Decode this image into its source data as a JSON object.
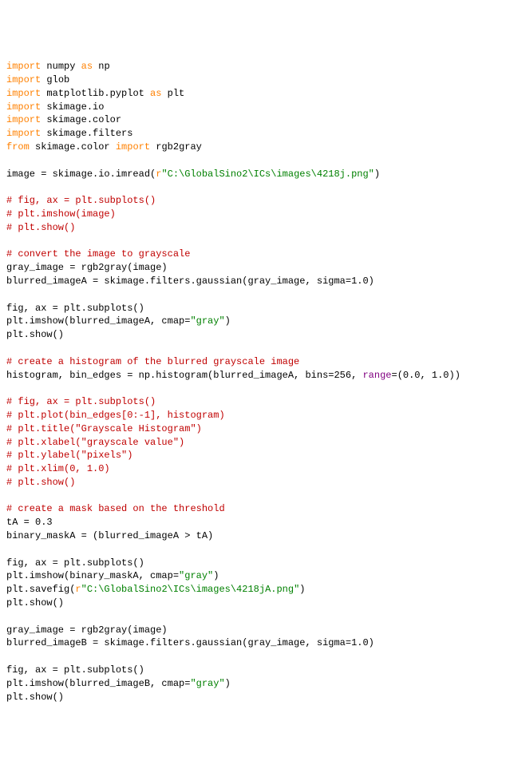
{
  "code": {
    "l01_import": "import",
    "l01_numpy": " numpy ",
    "l01_as": "as",
    "l01_np": " np",
    "l02_import": "import",
    "l02_rest": " glob",
    "l03_import": "import",
    "l03_rest": " matplotlib.pyplot ",
    "l03_as": "as",
    "l03_plt": " plt",
    "l04_import": "import",
    "l04_rest": " skimage.io",
    "l05_import": "import",
    "l05_rest": " skimage.color",
    "l06_import": "import",
    "l06_rest": " skimage.filters",
    "l07_from": "from",
    "l07_mid": " skimage.color ",
    "l07_import": "import",
    "l07_rest": " rgb2gray",
    "l09": "image = skimage.io.imread(",
    "l09_r": "r",
    "l09_str": "\"C:\\GlobalSino2\\ICs\\images\\4218j.png\"",
    "l09_end": ")",
    "l11": "# fig, ax = plt.subplots()",
    "l12": "# plt.imshow(image)",
    "l13": "# plt.show()",
    "l15": "# convert the image to grayscale",
    "l16": "gray_image = rgb2gray(image)",
    "l17": "blurred_imageA = skimage.filters.gaussian(gray_image, sigma=1.0)",
    "l19": "fig, ax = plt.subplots()",
    "l20a": "plt.imshow(blurred_imageA, cmap=",
    "l20s": "\"gray\"",
    "l20b": ")",
    "l21": "plt.show()",
    "l23": "# create a histogram of the blurred grayscale image",
    "l24a": "histogram, bin_edges = np.histogram(blurred_imageA, bins=256, ",
    "l24_range": "range",
    "l24b": "=(0.0, 1.0))",
    "l26": "# fig, ax = plt.subplots()",
    "l27": "# plt.plot(bin_edges[0:-1], histogram)",
    "l28": "# plt.title(\"Grayscale Histogram\")",
    "l29": "# plt.xlabel(\"grayscale value\")",
    "l30": "# plt.ylabel(\"pixels\")",
    "l31": "# plt.xlim(0, 1.0)",
    "l32": "# plt.show()",
    "l34": "# create a mask based on the threshold",
    "l35": "tA = 0.3",
    "l36": "binary_maskA = (blurred_imageA > tA)",
    "l38": "fig, ax = plt.subplots()",
    "l39a": "plt.imshow(binary_maskA, cmap=",
    "l39s": "\"gray\"",
    "l39b": ")",
    "l40a": "plt.savefig(",
    "l40_r": "r",
    "l40s": "\"C:\\GlobalSino2\\ICs\\images\\4218jA.png\"",
    "l40b": ")",
    "l41": "plt.show()",
    "l43": "gray_image = rgb2gray(image)",
    "l44": "blurred_imageB = skimage.filters.gaussian(gray_image, sigma=1.0)",
    "l46": "fig, ax = plt.subplots()",
    "l47a": "plt.imshow(blurred_imageB, cmap=",
    "l47s": "\"gray\"",
    "l47b": ")",
    "l48": "plt.show()"
  }
}
